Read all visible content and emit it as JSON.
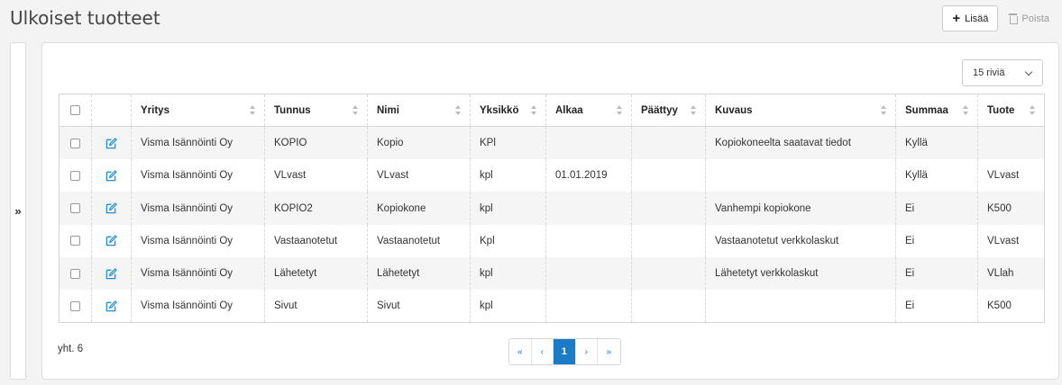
{
  "page": {
    "title": "Ulkoiset tuotteet",
    "add_label": "Lisää",
    "delete_label": "Poista",
    "toggle_glyph": "»"
  },
  "rows_select": {
    "value": "15 riviä"
  },
  "table": {
    "columns": [
      "Yritys",
      "Tunnus",
      "Nimi",
      "Yksikkö",
      "Alkaa",
      "Päättyy",
      "Kuvaus",
      "Summaa",
      "Tuote"
    ],
    "rows": [
      [
        "Visma Isännöinti Oy",
        "KOPIO",
        "Kopio",
        "KPl",
        "",
        "",
        "Kopiokoneelta saatavat tiedot",
        "Kyllä",
        ""
      ],
      [
        "Visma Isännöinti Oy",
        "VLvast",
        "VLvast",
        "kpl",
        "01.01.2019",
        "",
        "",
        "Kyllä",
        "VLvast"
      ],
      [
        "Visma Isännöinti Oy",
        "KOPIO2",
        "Kopiokone",
        "kpl",
        "",
        "",
        "Vanhempi kopiokone",
        "Ei",
        "K500"
      ],
      [
        "Visma Isännöinti Oy",
        "Vastaanotetut",
        "Vastaanotetut",
        "Kpl",
        "",
        "",
        "Vastaanotetut verkkolaskut",
        "Ei",
        "VLvast"
      ],
      [
        "Visma Isännöinti Oy",
        "Lähetetyt",
        "Lähetetyt",
        "kpl",
        "",
        "",
        "Lähetetyt verkkolaskut",
        "Ei",
        "VLlah"
      ],
      [
        "Visma Isännöinti Oy",
        "Sivut",
        "Sivut",
        "kpl",
        "",
        "",
        "",
        "Ei",
        "K500"
      ]
    ]
  },
  "footer": {
    "total": "yht. 6",
    "pager": {
      "first": "«",
      "prev": "‹",
      "current": "1",
      "next": "›",
      "last": "»"
    }
  },
  "colors": {
    "accent": "#1b7bc6",
    "edit_icon": "#1f8fd6"
  },
  "icons": {
    "add": "plus-icon",
    "delete": "trash-icon",
    "edit": "edit-icon",
    "sort": "sort-icon"
  }
}
